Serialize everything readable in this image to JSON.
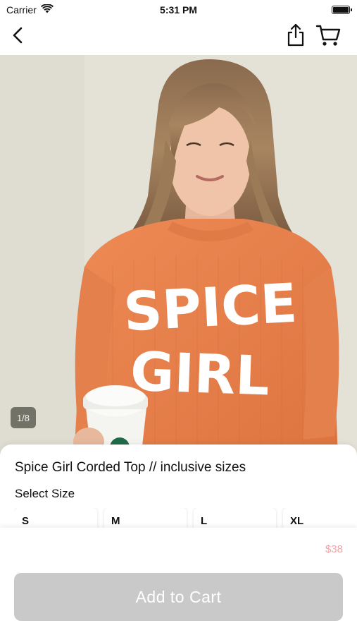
{
  "status_bar": {
    "carrier": "Carrier",
    "time": "5:31 PM",
    "wifi_icon": "wifi-icon",
    "battery_icon": "battery-icon"
  },
  "nav": {
    "back_icon": "chevron-left-icon",
    "share_icon": "share-icon",
    "cart_icon": "cart-icon"
  },
  "gallery": {
    "page_indicator": "1/8",
    "current_page": 1,
    "total_pages": 8,
    "sweater_print": [
      "SPICE",
      "GIRL"
    ],
    "sweater_color": "#e8804a"
  },
  "product": {
    "title": "Spice Girl Corded Top // inclusive sizes",
    "select_size_label": "Select Size",
    "sizes": [
      "S",
      "M",
      "L",
      "XL"
    ],
    "price": "$38"
  },
  "actions": {
    "add_to_cart_label": "Add to Cart"
  },
  "colors": {
    "price": "#f0a4a8",
    "button_disabled": "#c9c9c9"
  }
}
